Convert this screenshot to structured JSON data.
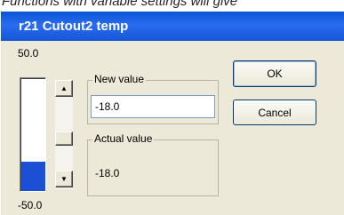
{
  "caption": "Functions with variable settings will give",
  "dialog": {
    "title": "r21 Cutout2 temp",
    "scale_max": "50.0",
    "scale_min": "-50.0",
    "gauge_fill_fraction": 0.26,
    "gauge_color": "#1c4fd4",
    "scroll_up_icon": "up-arrow-icon",
    "scroll_down_icon": "down-arrow-icon",
    "new_value": {
      "legend": "New value",
      "value": "-18.0"
    },
    "actual_value": {
      "legend": "Actual value",
      "value": "-18.0"
    },
    "ok_label": "OK",
    "cancel_label": "Cancel"
  },
  "colors": {
    "titlebar": "#0a54d6",
    "window_bg": "#ece9d8",
    "button_border": "#003c74"
  }
}
